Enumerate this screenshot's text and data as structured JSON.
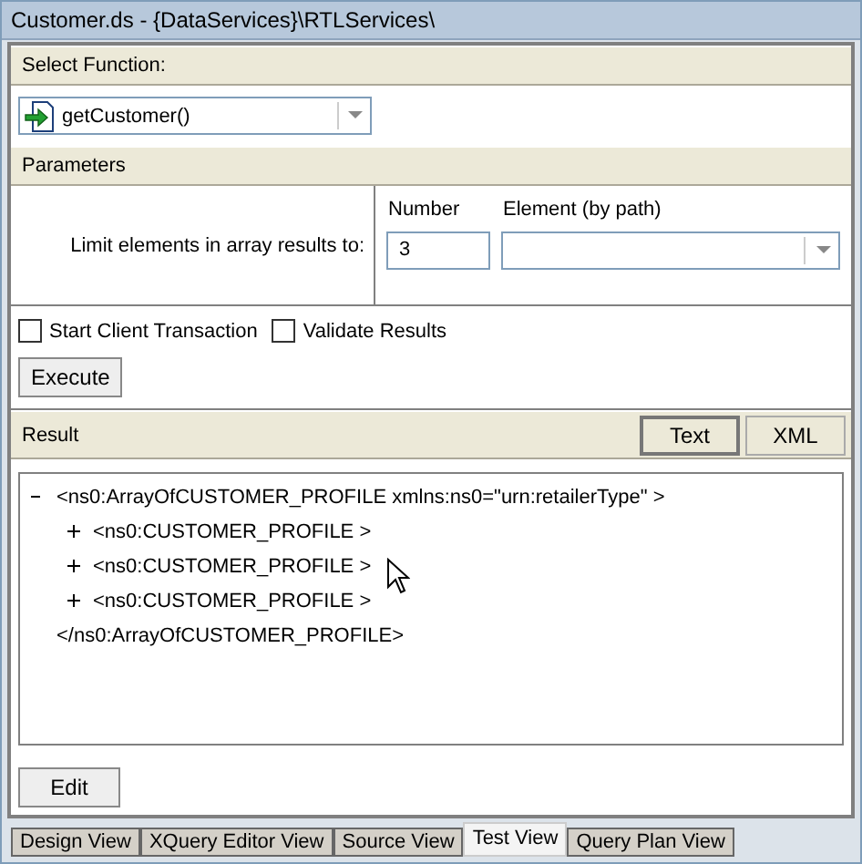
{
  "window": {
    "title": "Customer.ds - {DataServices}\\RTLServices\\"
  },
  "select_function": {
    "header": "Select Function:",
    "value": "getCustomer()"
  },
  "parameters": {
    "header": "Parameters",
    "label": "Limit elements in array results to:",
    "number_label": "Number",
    "number_value": "3",
    "element_label": "Element (by path)"
  },
  "options": [
    {
      "label": "Start Client Transaction",
      "checked": false
    },
    {
      "label": "Validate Results",
      "checked": false
    }
  ],
  "execute_button": "Execute",
  "result": {
    "header": "Result",
    "views": [
      {
        "label": "Text",
        "selected": true
      },
      {
        "label": "XML",
        "selected": false
      }
    ],
    "tree": [
      {
        "text": "<ns0:ArrayOfCUSTOMER_PROFILE xmlns:ns0=\"urn:retailerType\" >",
        "expanded": true,
        "closing": "</ns0:ArrayOfCUSTOMER_PROFILE>",
        "children": [
          {
            "text": "<ns0:CUSTOMER_PROFILE >",
            "expanded": false
          },
          {
            "text": "<ns0:CUSTOMER_PROFILE >",
            "expanded": false
          },
          {
            "text": "<ns0:CUSTOMER_PROFILE >",
            "expanded": false
          }
        ]
      }
    ]
  },
  "edit_button": "Edit",
  "tabs": [
    {
      "label": "Design View",
      "selected": false
    },
    {
      "label": "XQuery Editor View",
      "selected": false
    },
    {
      "label": "Source View",
      "selected": false
    },
    {
      "label": "Test View",
      "selected": true
    },
    {
      "label": "Query Plan View",
      "selected": false
    }
  ]
}
